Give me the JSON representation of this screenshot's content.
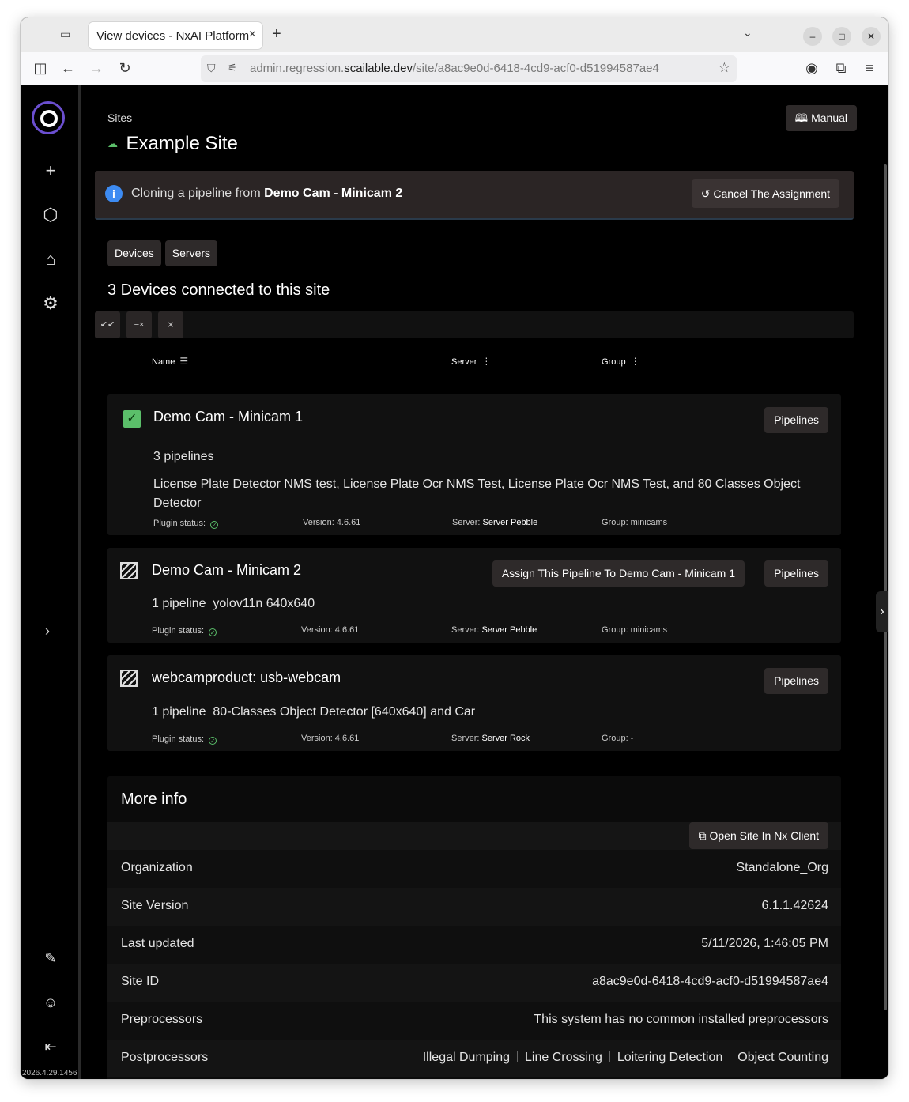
{
  "browser": {
    "tab_title": "View devices - NxAI Platform",
    "url_host_prefix": "admin.regression.",
    "url_host_main": "scailable.dev",
    "url_path": "/site/a8ac9e0d-6418-4cd9-acf0-d51994587ae4"
  },
  "sidebar": {
    "version": "2026.4.29.1456"
  },
  "header": {
    "breadcrumb": "Sites",
    "title": "Example Site",
    "manual_label": "Manual"
  },
  "alert": {
    "text_prefix": "Cloning a pipeline from",
    "source_device": "Demo Cam - Minicam 2",
    "cancel_label": "Cancel The Assignment"
  },
  "tabs": {
    "devices": "Devices",
    "servers": "Servers"
  },
  "devices_heading": "3 Devices connected to this site",
  "columns": {
    "name": "Name",
    "server": "Server",
    "group": "Group"
  },
  "devices": [
    {
      "name": "Demo Cam - Minicam 1",
      "pipelines_count": "3 pipelines",
      "pipelines_list": "License Plate Detector NMS test, License Plate Ocr NMS Test, License Plate Ocr NMS Test, and 80 Classes Object Detector",
      "plugin_status_label": "Plugin status:",
      "version": "Version: 4.6.61",
      "server_label": "Server:",
      "server": "Server Pebble",
      "group": "Group: minicams",
      "pipelines_btn": "Pipelines"
    },
    {
      "name": "Demo Cam - Minicam 2",
      "pipelines_count": "1 pipeline",
      "pipelines_list": "yolov11n 640x640",
      "plugin_status_label": "Plugin status:",
      "version": "Version: 4.6.61",
      "server_label": "Server:",
      "server": "Server Pebble",
      "group": "Group: minicams",
      "assign_btn": "Assign This Pipeline To Demo Cam - Minicam 1",
      "pipelines_btn": "Pipelines"
    },
    {
      "name": "webcamproduct: usb-webcam",
      "pipelines_count": "1 pipeline",
      "pipelines_list": "80-Classes Object Detector [640x640] and Car",
      "plugin_status_label": "Plugin status:",
      "version": "Version: 4.6.61",
      "server_label": "Server:",
      "server": "Server Rock",
      "group": "Group: -",
      "pipelines_btn": "Pipelines"
    }
  ],
  "more_info": {
    "title": "More info",
    "nx_btn": "Open Site In Nx Client",
    "rows": [
      {
        "label": "Organization",
        "value": "Standalone_Org"
      },
      {
        "label": "Site Version",
        "value": "6.1.1.42624"
      },
      {
        "label": "Last updated",
        "value": "5/11/2026, 1:46:05 PM"
      },
      {
        "label": "Site ID",
        "value": "a8ac9e0d-6418-4cd9-acf0-d51994587ae4"
      },
      {
        "label": "Preprocessors",
        "value": "This system has no common installed preprocessors"
      }
    ],
    "postprocessors_label": "Postprocessors",
    "postprocessors": [
      "Illegal Dumping",
      "Line Crossing",
      "Loitering Detection",
      "Object Counting"
    ]
  }
}
